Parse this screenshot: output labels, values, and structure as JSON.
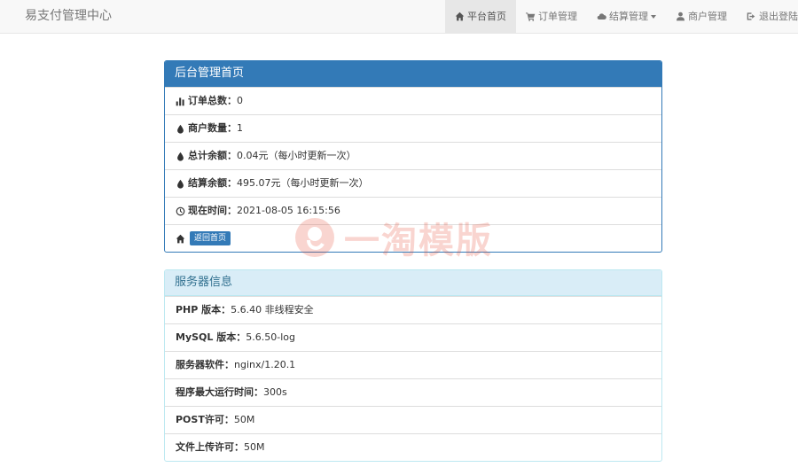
{
  "navbar": {
    "brand": "易支付管理中心",
    "items": [
      {
        "label": "平台首页",
        "icon": "home-icon",
        "active": true
      },
      {
        "label": "订单管理",
        "icon": "cart-icon"
      },
      {
        "label": "结算管理",
        "icon": "cloud-icon",
        "dropdown": true
      },
      {
        "label": "商户管理",
        "icon": "user-icon"
      },
      {
        "label": "退出登陆",
        "icon": "logout-icon"
      }
    ]
  },
  "admin_panel": {
    "title": "后台管理首页",
    "rows": [
      {
        "label": "订单总数：",
        "value": "0",
        "icon": "bar-chart-icon"
      },
      {
        "label": "商户数量：",
        "value": "1",
        "icon": "tint-icon"
      },
      {
        "label": "总计余额：",
        "value": "0.04元（每小时更新一次）",
        "icon": "tint-icon"
      },
      {
        "label": "结算余额：",
        "value": "495.07元（每小时更新一次）",
        "icon": "tint-icon"
      },
      {
        "label": "现在时间：",
        "value": "2021-08-05 16:15:56",
        "icon": "clock-icon"
      }
    ],
    "home_button": "返回首页"
  },
  "server_panel": {
    "title": "服务器信息",
    "rows": [
      {
        "label": "PHP 版本：",
        "value": "5.6.40 非线程安全"
      },
      {
        "label": "MySQL 版本：",
        "value": "5.6.50-log"
      },
      {
        "label": "服务器软件：",
        "value": "nginx/1.20.1"
      },
      {
        "label": "程序最大运行时间：",
        "value": "300s"
      },
      {
        "label": "POST许可：",
        "value": "50M"
      },
      {
        "label": "文件上传许可：",
        "value": "50M"
      }
    ]
  },
  "watermark": {
    "text": "一淘模版"
  },
  "colors": {
    "primary": "#337ab7",
    "info_bg": "#d9edf7",
    "info_text": "#31708f",
    "navbar_bg": "#f8f8f8"
  }
}
